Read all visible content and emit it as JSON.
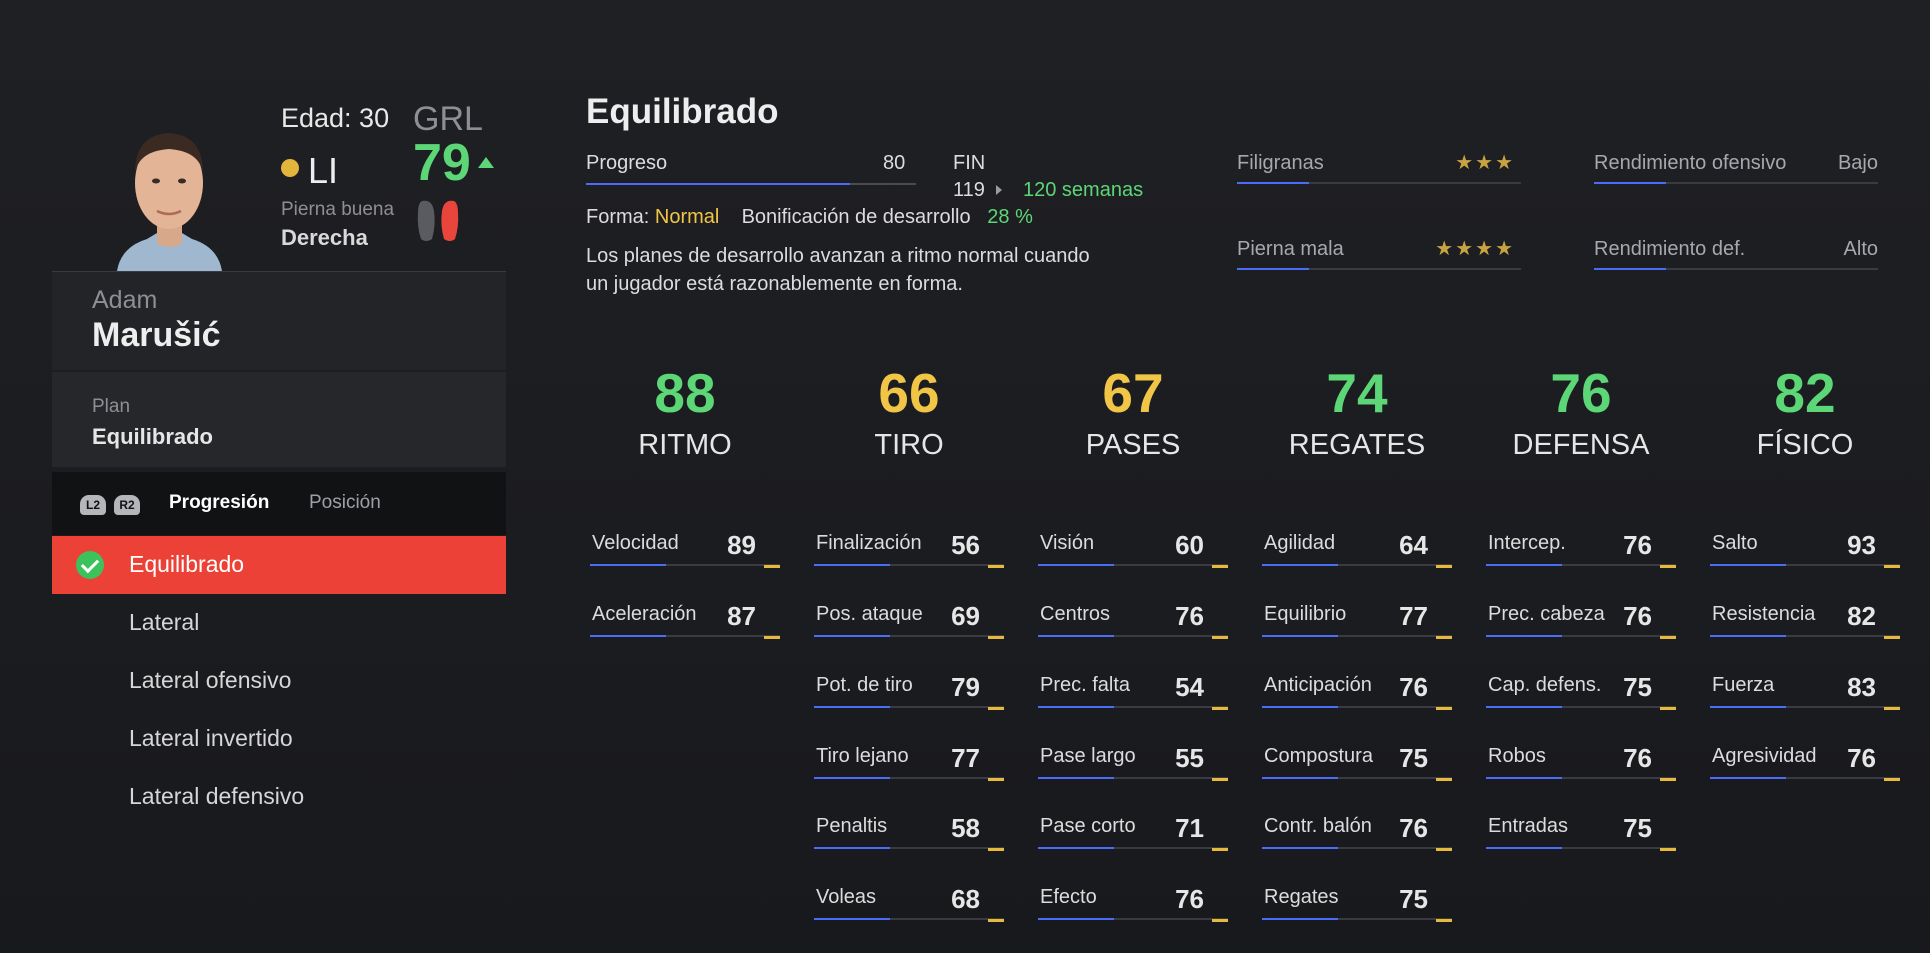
{
  "player": {
    "age_label": "Edad: 30",
    "ovr_label": "GRL",
    "ovr": "79",
    "position": "LI",
    "foot_label": "Pierna buena",
    "foot_value": "Derecha",
    "first_name": "Adam",
    "last_name": "Marušić",
    "plan_label": "Plan",
    "plan_value": "Equilibrado"
  },
  "tabs": {
    "hint_left": "L2",
    "hint_right": "R2",
    "active": "Progresión",
    "inactive": "Posición"
  },
  "plans": [
    {
      "label": "Equilibrado",
      "selected": true
    },
    {
      "label": "Lateral",
      "selected": false
    },
    {
      "label": "Lateral ofensivo",
      "selected": false
    },
    {
      "label": "Lateral invertido",
      "selected": false
    },
    {
      "label": "Lateral defensivo",
      "selected": false
    }
  ],
  "header": {
    "title": "Equilibrado",
    "progress_label": "Progreso",
    "progress_value": "80",
    "progress_fraction": 0.8,
    "fin_label": "FIN",
    "fin_current": "119",
    "fin_target": "120 semanas",
    "form_label": "Forma:",
    "form_value": "Normal",
    "bonus_label": "Bonificación de desarrollo",
    "bonus_value": "28 %",
    "description": "Los planes de desarrollo avanzan a ritmo normal cuando un jugador está razonablemente en forma."
  },
  "traits": {
    "skill_moves_label": "Filigranas",
    "skill_moves_stars": "★★★",
    "weak_foot_label": "Pierna mala",
    "weak_foot_stars": "★★★★",
    "att_rate_label": "Rendimiento ofensivo",
    "att_rate_value": "Bajo",
    "def_rate_label": "Rendimiento def.",
    "def_rate_value": "Alto"
  },
  "colors": {
    "green": "#5cd676",
    "yellow": "#f1c646",
    "accent_red": "#ec4136",
    "bar_blue": "#4a6cf7"
  },
  "categories": [
    {
      "name": "RITMO",
      "value": "88",
      "color": "#5cd676",
      "stats": [
        {
          "name": "Velocidad",
          "value": "89"
        },
        {
          "name": "Aceleración",
          "value": "87"
        }
      ]
    },
    {
      "name": "TIRO",
      "value": "66",
      "color": "#f1c646",
      "stats": [
        {
          "name": "Finalización",
          "value": "56"
        },
        {
          "name": "Pos. ataque",
          "value": "69"
        },
        {
          "name": "Pot. de tiro",
          "value": "79"
        },
        {
          "name": "Tiro lejano",
          "value": "77"
        },
        {
          "name": "Penaltis",
          "value": "58"
        },
        {
          "name": "Voleas",
          "value": "68"
        }
      ]
    },
    {
      "name": "PASES",
      "value": "67",
      "color": "#f1c646",
      "stats": [
        {
          "name": "Visión",
          "value": "60"
        },
        {
          "name": "Centros",
          "value": "76"
        },
        {
          "name": "Prec. falta",
          "value": "54"
        },
        {
          "name": "Pase largo",
          "value": "55"
        },
        {
          "name": "Pase corto",
          "value": "71"
        },
        {
          "name": "Efecto",
          "value": "76"
        }
      ]
    },
    {
      "name": "REGATES",
      "value": "74",
      "color": "#5cd676",
      "stats": [
        {
          "name": "Agilidad",
          "value": "64"
        },
        {
          "name": "Equilibrio",
          "value": "77"
        },
        {
          "name": "Anticipación",
          "value": "76"
        },
        {
          "name": "Compostura",
          "value": "75"
        },
        {
          "name": "Contr. balón",
          "value": "76"
        },
        {
          "name": "Regates",
          "value": "75"
        }
      ]
    },
    {
      "name": "DEFENSA",
      "value": "76",
      "color": "#5cd676",
      "stats": [
        {
          "name": "Intercep.",
          "value": "76"
        },
        {
          "name": "Prec. cabeza",
          "value": "76"
        },
        {
          "name": "Cap. defens.",
          "value": "75"
        },
        {
          "name": "Robos",
          "value": "76"
        },
        {
          "name": "Entradas",
          "value": "75"
        }
      ]
    },
    {
      "name": "FÍSICO",
      "value": "82",
      "color": "#5cd676",
      "stats": [
        {
          "name": "Salto",
          "value": "93"
        },
        {
          "name": "Resistencia",
          "value": "82"
        },
        {
          "name": "Fuerza",
          "value": "83"
        },
        {
          "name": "Agresividad",
          "value": "76"
        }
      ]
    }
  ]
}
